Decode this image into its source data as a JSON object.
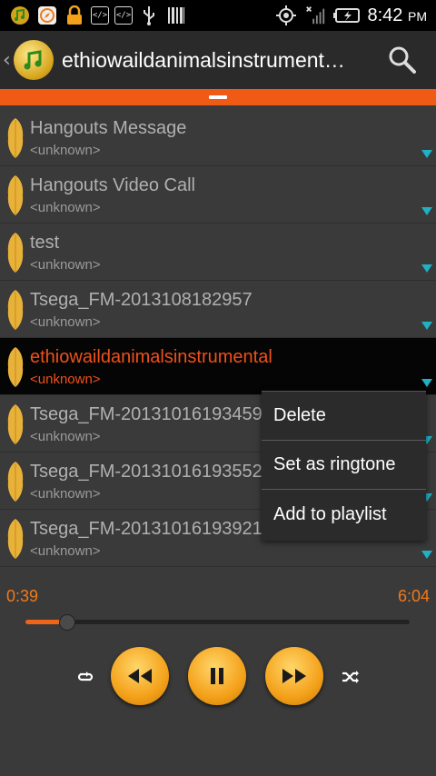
{
  "status_bar": {
    "time": "8:42",
    "ampm": "PM",
    "left_icons": [
      "music-notification-icon",
      "compass-icon",
      "lock-icon",
      "code-icon",
      "code-icon",
      "usb-icon",
      "barcode-icon"
    ],
    "right_icons": [
      "gps-icon",
      "no-signal-icon",
      "battery-charging-icon"
    ]
  },
  "action_bar": {
    "title": "ethiowaildanimalsinstrument…",
    "search_icon": "search-icon"
  },
  "tracks": [
    {
      "title": "Hangouts Message",
      "artist": "<unknown>",
      "active": false
    },
    {
      "title": "Hangouts Video Call",
      "artist": "<unknown>",
      "active": false
    },
    {
      "title": "test",
      "artist": "<unknown>",
      "active": false
    },
    {
      "title": "Tsega_FM-2013108182957",
      "artist": "<unknown>",
      "active": false
    },
    {
      "title": "ethiowaildanimalsinstrumental",
      "artist": "<unknown>",
      "active": true
    },
    {
      "title": "Tsega_FM-20131016193459",
      "artist": "<unknown>",
      "active": false
    },
    {
      "title": "Tsega_FM-20131016193552",
      "artist": "<unknown>",
      "active": false
    },
    {
      "title": "Tsega_FM-20131016193921",
      "artist": "<unknown>",
      "active": false
    }
  ],
  "context_menu": {
    "items": [
      "Delete",
      "Set as ringtone",
      "Add to playlist"
    ]
  },
  "player": {
    "elapsed": "0:39",
    "total": "6:04",
    "progress_fraction": 0.107,
    "controls": [
      "repeat-icon",
      "rewind-icon",
      "pause-icon",
      "fast-forward-icon",
      "shuffle-icon"
    ]
  },
  "colors": {
    "accent": "#ef5a14",
    "active_text": "#f0501a",
    "indicator": "#1fb1c4",
    "button_gold": "#f4a11a"
  }
}
